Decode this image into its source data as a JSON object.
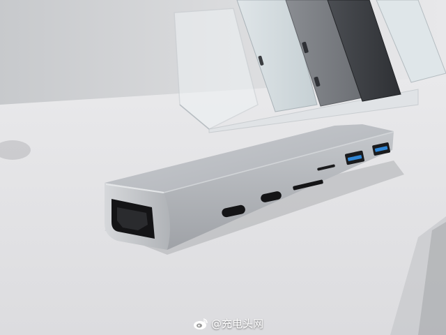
{
  "photo": {
    "subject": "silver-usb-c-hub",
    "hub_ports": [
      "hdmi-port",
      "usb-c-port",
      "usb-c-port",
      "sd-card-slot",
      "microsd-slot",
      "usb-a-port",
      "usb-a-port"
    ],
    "background": "acrylic-display-stand-with-hubs",
    "colors": {
      "table": "#e7e7ea",
      "wall": "#d8d9db",
      "hub_body": "#b9bcc0",
      "usb_a_accent": "#2f86d6"
    }
  },
  "watermark": {
    "text": "@充电头网",
    "icon": "weibo-logo-icon"
  }
}
